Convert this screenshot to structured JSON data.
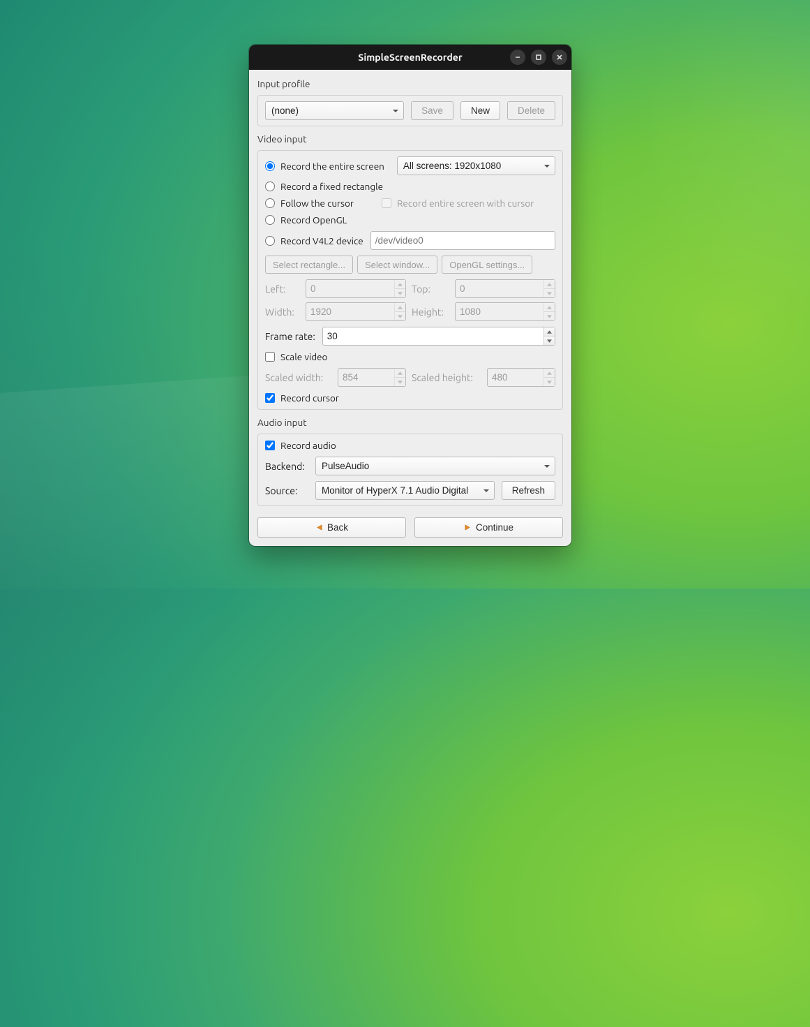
{
  "window": {
    "title": "SimpleScreenRecorder"
  },
  "input_profile": {
    "label": "Input profile",
    "selected": "(none)",
    "save": "Save",
    "new": "New",
    "delete": "Delete"
  },
  "video": {
    "label": "Video input",
    "radio_entire": "Record the entire screen",
    "screens_select": "All screens: 1920x1080",
    "radio_rect": "Record a fixed rectangle",
    "radio_cursor": "Follow the cursor",
    "check_entire_cursor": "Record entire screen with cursor",
    "radio_opengl": "Record OpenGL",
    "radio_v4l2": "Record V4L2 device",
    "v4l2_placeholder": "/dev/video0",
    "btn_select_rect": "Select rectangle...",
    "btn_select_window": "Select window...",
    "btn_opengl_settings": "OpenGL settings...",
    "left_label": "Left:",
    "left_val": "0",
    "top_label": "Top:",
    "top_val": "0",
    "width_label": "Width:",
    "width_val": "1920",
    "height_label": "Height:",
    "height_val": "1080",
    "framerate_label": "Frame rate:",
    "framerate_val": "30",
    "scale_label": "Scale video",
    "scaled_w_label": "Scaled width:",
    "scaled_w_val": "854",
    "scaled_h_label": "Scaled height:",
    "scaled_h_val": "480",
    "record_cursor_label": "Record cursor"
  },
  "audio": {
    "label": "Audio input",
    "record_label": "Record audio",
    "backend_label": "Backend:",
    "backend_val": "PulseAudio",
    "source_label": "Source:",
    "source_val": "Monitor of HyperX 7.1 Audio Digital",
    "refresh": "Refresh"
  },
  "footer": {
    "back": "Back",
    "continue": "Continue"
  }
}
